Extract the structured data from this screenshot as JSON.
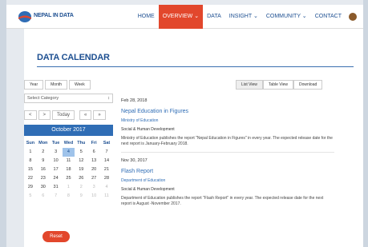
{
  "header": {
    "logo_text": "NEPAL IN DATA",
    "nav": [
      {
        "label": "HOME"
      },
      {
        "label": "OVERVIEW ⌄"
      },
      {
        "label": "DATA"
      },
      {
        "label": "INSIGHT ⌄"
      },
      {
        "label": "COMMUNITY ⌄"
      },
      {
        "label": "CONTACT"
      }
    ],
    "active_index": 1
  },
  "page": {
    "title": "DATA CALENDAR"
  },
  "sidebar": {
    "view_buttons": [
      "Year",
      "Month",
      "Week"
    ],
    "category_placeholder": "Select Category",
    "category_arrow": "↕",
    "nav_buttons": [
      "<",
      ">",
      "Today",
      "«",
      "»"
    ],
    "month_label": "October 2017",
    "weekdays": [
      "Sun",
      "Mon",
      "Tue",
      "Wed",
      "Thu",
      "Fri",
      "Sat"
    ],
    "weeks": [
      [
        "1",
        "2",
        "3",
        "4",
        "5",
        "6",
        "7"
      ],
      [
        "8",
        "9",
        "10",
        "11",
        "12",
        "13",
        "14"
      ],
      [
        "15",
        "16",
        "17",
        "18",
        "19",
        "20",
        "21"
      ],
      [
        "22",
        "23",
        "24",
        "25",
        "26",
        "27",
        "28"
      ],
      [
        "29",
        "30",
        "31",
        "1",
        "2",
        "3",
        "4"
      ],
      [
        "5",
        "6",
        "7",
        "8",
        "9",
        "10",
        "11"
      ]
    ],
    "selected_day": "4",
    "reset_label": "Reset"
  },
  "main": {
    "view_tabs": [
      "List View",
      "Table View",
      "Download"
    ],
    "events": [
      {
        "date": "Feb 28, 2018",
        "title": "Nepal Education in Figures",
        "ministry": "Ministry of Education",
        "category": "Social & Human Development",
        "description": "Ministry of Education publishes the report \"Nepal Education in Figures\" in every year. The expected release date for the next report is January-February 2018."
      },
      {
        "date": "Nov 30, 2017",
        "title": "Flash Report",
        "ministry": "Department of Education",
        "category": "Social & Human Development",
        "description": "Department of Education publishes the report \"Flash Report\" in every year. The expected release date for the next report is August -November 2017."
      }
    ]
  },
  "colors": {
    "brand_blue": "#1d4f91",
    "accent_red": "#e2472c",
    "month_bar": "#2f6db5",
    "selected_day": "#9fc3ea"
  }
}
